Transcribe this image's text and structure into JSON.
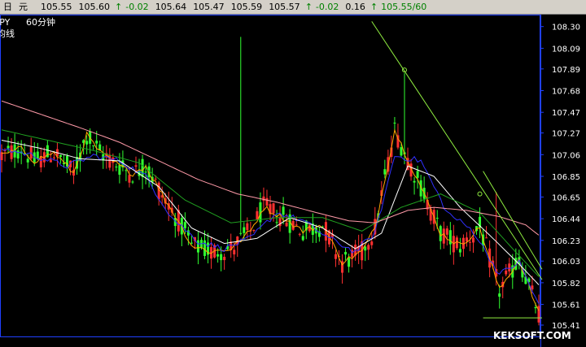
{
  "topbar": {
    "items": [
      {
        "text": "日",
        "type": "label"
      },
      {
        "text": "元",
        "type": "label"
      },
      {
        "text": "105.55",
        "type": "value"
      },
      {
        "text": "105.60",
        "type": "value"
      },
      {
        "text": "-0.02",
        "type": "change"
      },
      {
        "text": "105.64",
        "type": "value"
      },
      {
        "text": "105.47",
        "type": "value"
      },
      {
        "text": "105.59",
        "type": "value"
      },
      {
        "text": "105.57",
        "type": "value"
      },
      {
        "text": "-0.02",
        "type": "change"
      },
      {
        "text": "0.16",
        "type": "value"
      },
      {
        "text": "105.55/60",
        "type": "change"
      }
    ]
  },
  "chart_header": {
    "symbol": "JPY",
    "period": "60分钟",
    "indicator": "均线"
  },
  "watermark": "KEKSOFT.COM",
  "chart_data": {
    "type": "line",
    "ylim": [
      105.3,
      108.4
    ],
    "y_ticks": [
      "108.30",
      "108.09",
      "107.89",
      "107.68",
      "107.47",
      "107.27",
      "107.06",
      "106.85",
      "106.65",
      "106.44",
      "106.23",
      "106.03",
      "105.82",
      "105.61",
      "105.41"
    ],
    "n_points": 165,
    "series": [
      {
        "color": "#ffa500",
        "anchors": [
          [
            0,
            107.05
          ],
          [
            6,
            107.12
          ],
          [
            10,
            107.0
          ],
          [
            16,
            107.08
          ],
          [
            22,
            106.88
          ],
          [
            26,
            107.25
          ],
          [
            30,
            107.08
          ],
          [
            36,
            106.95
          ],
          [
            40,
            106.88
          ],
          [
            44,
            106.95
          ],
          [
            50,
            106.62
          ],
          [
            54,
            106.42
          ],
          [
            58,
            106.18
          ],
          [
            64,
            106.12
          ],
          [
            70,
            106.15
          ],
          [
            76,
            106.32
          ],
          [
            80,
            106.55
          ],
          [
            86,
            106.45
          ],
          [
            92,
            106.32
          ],
          [
            98,
            106.38
          ],
          [
            104,
            106.02
          ],
          [
            110,
            106.12
          ],
          [
            114,
            106.35
          ],
          [
            120,
            107.3
          ],
          [
            124,
            107.02
          ],
          [
            128,
            106.75
          ],
          [
            134,
            106.3
          ],
          [
            140,
            106.18
          ],
          [
            146,
            106.35
          ],
          [
            152,
            105.75
          ],
          [
            158,
            106.05
          ],
          [
            164,
            105.52
          ]
        ]
      },
      {
        "color": "#3030ff",
        "anchors": [
          [
            0,
            107.12
          ],
          [
            10,
            107.05
          ],
          [
            20,
            106.95
          ],
          [
            28,
            107.05
          ],
          [
            36,
            107.0
          ],
          [
            44,
            106.85
          ],
          [
            52,
            106.45
          ],
          [
            60,
            106.22
          ],
          [
            68,
            106.15
          ],
          [
            76,
            106.25
          ],
          [
            84,
            106.5
          ],
          [
            92,
            106.42
          ],
          [
            100,
            106.25
          ],
          [
            108,
            106.12
          ],
          [
            114,
            106.3
          ],
          [
            120,
            107.05
          ],
          [
            128,
            107.0
          ],
          [
            136,
            106.5
          ],
          [
            144,
            106.32
          ],
          [
            152,
            105.9
          ],
          [
            158,
            106.02
          ],
          [
            164,
            105.6
          ]
        ]
      },
      {
        "color": "#ffffff",
        "anchors": [
          [
            0,
            107.2
          ],
          [
            12,
            107.12
          ],
          [
            24,
            107.02
          ],
          [
            36,
            107.0
          ],
          [
            48,
            106.75
          ],
          [
            58,
            106.35
          ],
          [
            68,
            106.2
          ],
          [
            78,
            106.25
          ],
          [
            88,
            106.45
          ],
          [
            98,
            106.35
          ],
          [
            108,
            106.15
          ],
          [
            116,
            106.3
          ],
          [
            124,
            106.95
          ],
          [
            132,
            106.85
          ],
          [
            140,
            106.55
          ],
          [
            150,
            106.25
          ],
          [
            158,
            106.0
          ],
          [
            164,
            105.8
          ]
        ]
      },
      {
        "color": "#20a020",
        "anchors": [
          [
            0,
            107.3
          ],
          [
            14,
            107.2
          ],
          [
            28,
            107.1
          ],
          [
            42,
            106.98
          ],
          [
            56,
            106.62
          ],
          [
            70,
            106.4
          ],
          [
            84,
            106.45
          ],
          [
            98,
            106.45
          ],
          [
            110,
            106.32
          ],
          [
            122,
            106.55
          ],
          [
            134,
            106.68
          ],
          [
            146,
            106.5
          ],
          [
            156,
            106.15
          ],
          [
            164,
            105.88
          ]
        ]
      },
      {
        "color": "#ff9aa8",
        "anchors": [
          [
            0,
            107.58
          ],
          [
            12,
            107.45
          ],
          [
            24,
            107.32
          ],
          [
            36,
            107.18
          ],
          [
            48,
            107.0
          ],
          [
            60,
            106.82
          ],
          [
            72,
            106.68
          ],
          [
            84,
            106.6
          ],
          [
            96,
            106.5
          ],
          [
            106,
            106.42
          ],
          [
            114,
            106.4
          ],
          [
            124,
            106.52
          ],
          [
            132,
            106.55
          ],
          [
            142,
            106.52
          ],
          [
            152,
            106.46
          ],
          [
            160,
            106.38
          ],
          [
            164,
            106.28
          ]
        ]
      }
    ],
    "bars_series_colors": {
      "up": "#ff3030",
      "down": "#30ff30"
    },
    "trendlines": [
      {
        "color": "#90ee40",
        "from": [
          113,
          108.35
        ],
        "to": [
          165,
          105.85
        ]
      },
      {
        "color": "#90ee40",
        "from": [
          147,
          106.9
        ],
        "to": [
          165,
          105.95
        ]
      },
      {
        "color": "#90ee40",
        "from": [
          147,
          105.48
        ],
        "to": [
          165,
          105.48
        ]
      }
    ],
    "spikes": [
      [
        73,
        108.2
      ],
      [
        123,
        107.85
      ],
      [
        146,
        106.55
      ],
      [
        151,
        106.7
      ]
    ]
  }
}
